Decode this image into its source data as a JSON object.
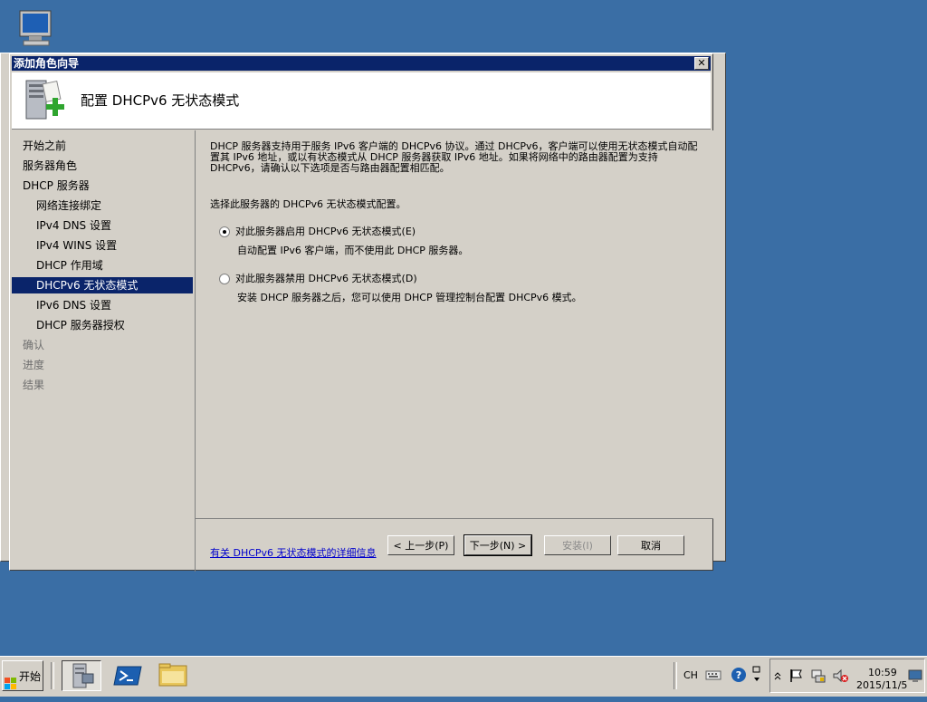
{
  "window": {
    "title": "添加角色向导",
    "close_label": "✕",
    "header_title": "配置 DHCPv6 无状态模式"
  },
  "sidebar": {
    "items": [
      {
        "label": "开始之前",
        "level": 0,
        "state": "normal"
      },
      {
        "label": "服务器角色",
        "level": 0,
        "state": "normal"
      },
      {
        "label": "DHCP 服务器",
        "level": 0,
        "state": "normal"
      },
      {
        "label": "网络连接绑定",
        "level": 1,
        "state": "normal"
      },
      {
        "label": "IPv4 DNS 设置",
        "level": 1,
        "state": "normal"
      },
      {
        "label": "IPv4 WINS 设置",
        "level": 1,
        "state": "normal"
      },
      {
        "label": "DHCP 作用域",
        "level": 1,
        "state": "normal"
      },
      {
        "label": "DHCPv6 无状态模式",
        "level": 1,
        "state": "active"
      },
      {
        "label": "IPv6 DNS 设置",
        "level": 1,
        "state": "normal"
      },
      {
        "label": "DHCP 服务器授权",
        "level": 1,
        "state": "normal"
      },
      {
        "label": "确认",
        "level": 0,
        "state": "disabled"
      },
      {
        "label": "进度",
        "level": 0,
        "state": "disabled"
      },
      {
        "label": "结果",
        "level": 0,
        "state": "disabled"
      }
    ]
  },
  "content": {
    "description": "DHCP 服务器支持用于服务 IPv6 客户端的 DHCPv6 协议。通过 DHCPv6，客户端可以使用无状态模式自动配置其 IPv6 地址，或以有状态模式从 DHCP 服务器获取 IPv6 地址。如果将网络中的路由器配置为支持 DHCPv6，请确认以下选项是否与路由器配置相匹配。",
    "prompt": "选择此服务器的 DHCPv6 无状态模式配置。",
    "option_enable_label": "对此服务器启用 DHCPv6 无状态模式(E)",
    "option_enable_desc": "自动配置 IPv6 客户端，而不使用此 DHCP 服务器。",
    "option_enable_selected": true,
    "option_disable_label": "对此服务器禁用 DHCPv6 无状态模式(D)",
    "option_disable_desc": "安装 DHCP 服务器之后，您可以使用 DHCP 管理控制台配置 DHCPv6 模式。",
    "option_disable_selected": false,
    "info_link": "有关 DHCPv6 无状态模式的详细信息"
  },
  "buttons": {
    "back": "< 上一步(P)",
    "next": "下一步(N) >",
    "install": "安装(I)",
    "cancel": "取消"
  },
  "taskbar": {
    "start_label": "开始",
    "language": "CH",
    "time": "10:59",
    "date": "2015/11/5"
  }
}
